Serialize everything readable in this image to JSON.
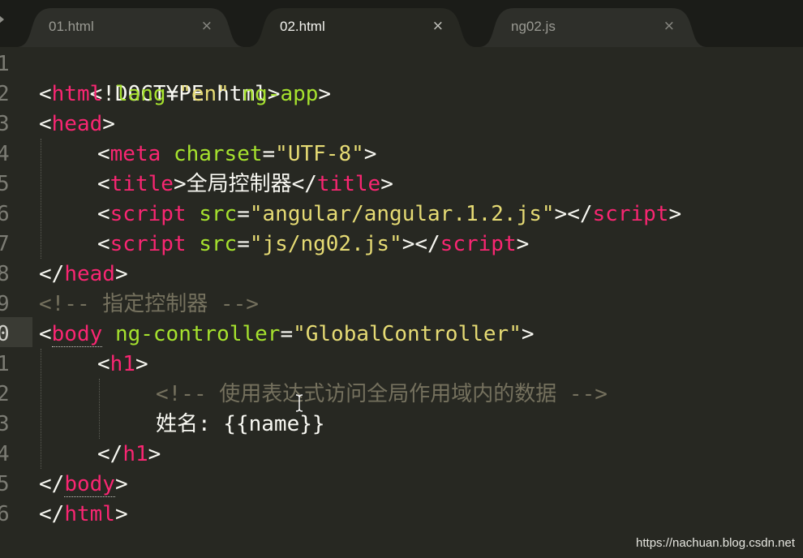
{
  "tabs": [
    {
      "label": "01.html",
      "close": "×",
      "active": false
    },
    {
      "label": "02.html",
      "close": "×",
      "active": true
    },
    {
      "label": "ng02.js",
      "close": "×",
      "active": false
    }
  ],
  "line_numbers": [
    "1",
    "2",
    "3",
    "4",
    "5",
    "6",
    "7",
    "8",
    "9",
    "0",
    "1",
    "2",
    "3",
    "4",
    "5",
    "6"
  ],
  "code": {
    "l1": {
      "text": "<!DOCTYPE html>"
    },
    "l2": {
      "lt": "<",
      "tag": "html",
      "sp1": " ",
      "attr1": "lang",
      "eq1": "=",
      "val1": "\"en\"",
      "sp2": " ",
      "attr2": "ng-app",
      "gt": ">"
    },
    "l3": {
      "lt": "<",
      "tag": "head",
      "gt": ">"
    },
    "l4": {
      "lt": "<",
      "tag": "meta",
      "sp": " ",
      "attr": "charset",
      "eq": "=",
      "val": "\"UTF-8\"",
      "gt": ">"
    },
    "l5": {
      "lt": "<",
      "tag": "title",
      "gt": ">",
      "text": "全局控制器",
      "lt2": "</",
      "tag2": "title",
      "gt2": ">"
    },
    "l6": {
      "lt": "<",
      "tag": "script",
      "sp": " ",
      "attr": "src",
      "eq": "=",
      "val": "\"angular/angular.1.2.js\"",
      "gt": ">",
      "lt2": "</",
      "tag2": "script",
      "gt2": ">"
    },
    "l7": {
      "lt": "<",
      "tag": "script",
      "sp": " ",
      "attr": "src",
      "eq": "=",
      "val": "\"js/ng02.js\"",
      "gt": ">",
      "lt2": "</",
      "tag2": "script",
      "gt2": ">"
    },
    "l8": {
      "lt": "</",
      "tag": "head",
      "gt": ">"
    },
    "l9": {
      "comment": "<!-- 指定控制器 -->"
    },
    "l10": {
      "lt": "<",
      "tag": "body",
      "sp": " ",
      "attr": "ng-controller",
      "eq": "=",
      "val": "\"GlobalController\"",
      "gt": ">"
    },
    "l11": {
      "lt": "<",
      "tag": "h1",
      "gt": ">"
    },
    "l12": {
      "comment": "<!-- 使用表达式访问全局作用域内的数据 -->"
    },
    "l13": {
      "text": "姓名: {{name}}"
    },
    "l14": {
      "lt": "</",
      "tag": "h1",
      "gt": ">"
    },
    "l15": {
      "lt": "</",
      "tag": "body",
      "gt": ">"
    },
    "l16": {
      "lt": "</",
      "tag": "html",
      "gt": ">"
    }
  },
  "watermark": "https://nachuan.blog.csdn.net",
  "colors": {
    "background": "#272822",
    "tag": "#f92672",
    "attribute": "#a6e22e",
    "string": "#e6db74",
    "comment": "#75715e",
    "text": "#f8f8f2"
  }
}
